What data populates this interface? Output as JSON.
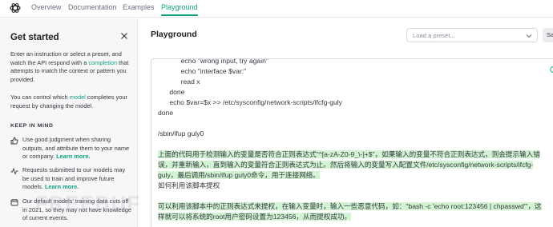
{
  "nav": {
    "links": [
      "Overview",
      "Documentation",
      "Examples",
      "Playground"
    ]
  },
  "sidebar": {
    "title": "Get started",
    "intro_1": "Enter an instruction or select a preset, and watch the API respond with a ",
    "intro_link": "completion",
    "intro_2": " that attempts to match the context or pattern you provided.",
    "control_1": "You can control which ",
    "control_link": "model",
    "control_2": " completes your request by changing the model.",
    "section_heading": "KEEP IN MIND",
    "items": [
      {
        "text": "Use good judgment when sharing outputs, and attribute them to your name or company. ",
        "link": "Learn more."
      },
      {
        "text": "Requests submitted to our models may be used to train and improve future models. ",
        "link": "Learn more."
      },
      {
        "text": "Our default models' training data cuts off in 2021, so they may not have knowledge of current events.",
        "link": ""
      }
    ]
  },
  "main": {
    "title": "Playground",
    "preset_placeholder": "Load a preset...",
    "save_label": "Sa"
  },
  "editor": {
    "lines": [
      "            echo \"wrong input, try again\"",
      "            echo \"interface $var:\"",
      "            read x",
      "      done",
      "      echo $var=$x >> /etc/sysconfig/network-scripts/ifcfg-guly",
      "done",
      "",
      "/sbin/ifup guly0",
      ""
    ],
    "para1": "上面的代码用于检测输入的变量是否符合正则表达式\"^[a-zA-Z0-9_\\-]+$\"，如果输入的变量不符合正则表达式，则会提示输入错误，并重新输入，直到输入的变量符合正则表达式为止。然后将输入的变量写入配置文件/etc/sysconfig/network-scripts/ifcfg-guly，最后调用/sbin/ifup guly0命令，用于连接网络。",
    "prompt": "如何利用该脚本提权",
    "para2": "可以利用该脚本中的正则表达式来提权，在输入变量时，输入一些恶意代码，如：\"bash -c 'echo root:123456 | chpasswd'\"，这样就可以将系统的root用户密码设置为123456，从而提权成功。"
  },
  "watermark": "FREEBUF"
}
